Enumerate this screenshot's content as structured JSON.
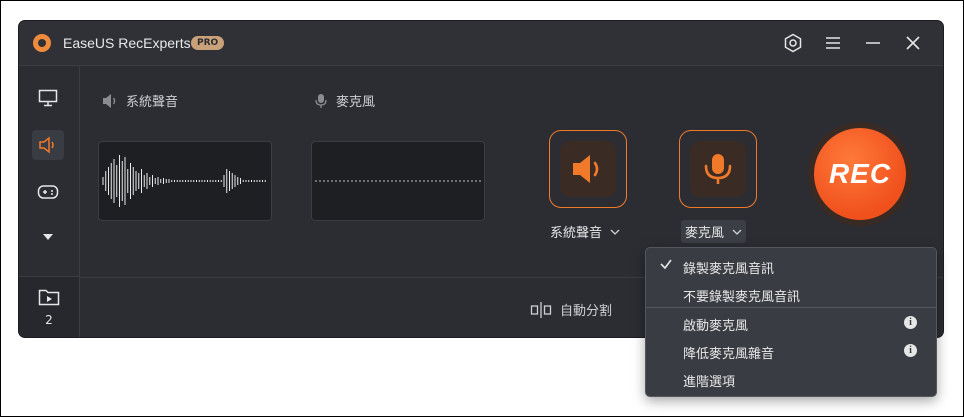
{
  "app": {
    "title": "EaseUS RecExperts",
    "badge": "PRO"
  },
  "titlebar": {
    "settings_icon": "hexagon-settings-icon",
    "menu_icon": "menu-icon",
    "minimize_icon": "minimize-icon",
    "close_icon": "close-icon"
  },
  "sidebar": {
    "items": [
      {
        "icon": "monitor-icon"
      },
      {
        "icon": "speaker-icon",
        "active": true
      },
      {
        "icon": "gamepad-icon"
      },
      {
        "icon": "chevron-down-icon"
      }
    ],
    "recordings_count": "2"
  },
  "sources": {
    "system_sound_label": "系統聲音",
    "microphone_label": "麥克風"
  },
  "controls": {
    "system_sound_dropdown": "系統聲音",
    "microphone_dropdown": "麥克風",
    "rec_label": "REC"
  },
  "bottom": {
    "split_label": "自動分割"
  },
  "menu": {
    "items": [
      {
        "label": "錄製麥克風音訊",
        "checked": true
      },
      {
        "label": "不要錄製麥克風音訊"
      },
      {
        "label": "啟動麥克風",
        "info": "i"
      },
      {
        "label": "降低麥克風雜音",
        "info": "i"
      },
      {
        "label": "進階選項"
      }
    ]
  },
  "colors": {
    "accent": "#f07a2a",
    "rec": "#f0501c",
    "bg": "#2b2d33"
  }
}
